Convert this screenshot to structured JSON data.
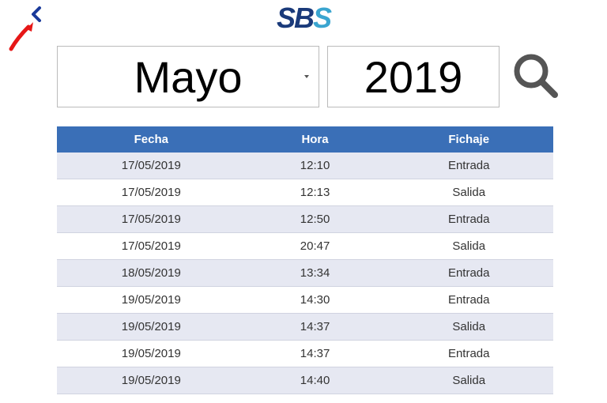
{
  "logo": {
    "s1": "S",
    "b": "B",
    "s2": "S"
  },
  "controls": {
    "month": "Mayo",
    "year": "2019"
  },
  "table": {
    "headers": {
      "date": "Fecha",
      "time": "Hora",
      "type": "Fichaje"
    },
    "rows": [
      {
        "date": "17/05/2019",
        "time": "12:10",
        "type": "Entrada"
      },
      {
        "date": "17/05/2019",
        "time": "12:13",
        "type": "Salida"
      },
      {
        "date": "17/05/2019",
        "time": "12:50",
        "type": "Entrada"
      },
      {
        "date": "17/05/2019",
        "time": "20:47",
        "type": "Salida"
      },
      {
        "date": "18/05/2019",
        "time": "13:34",
        "type": "Entrada"
      },
      {
        "date": "19/05/2019",
        "time": "14:30",
        "type": "Entrada"
      },
      {
        "date": "19/05/2019",
        "time": "14:37",
        "type": "Salida"
      },
      {
        "date": "19/05/2019",
        "time": "14:37",
        "type": "Entrada"
      },
      {
        "date": "19/05/2019",
        "time": "14:40",
        "type": "Salida"
      }
    ]
  }
}
